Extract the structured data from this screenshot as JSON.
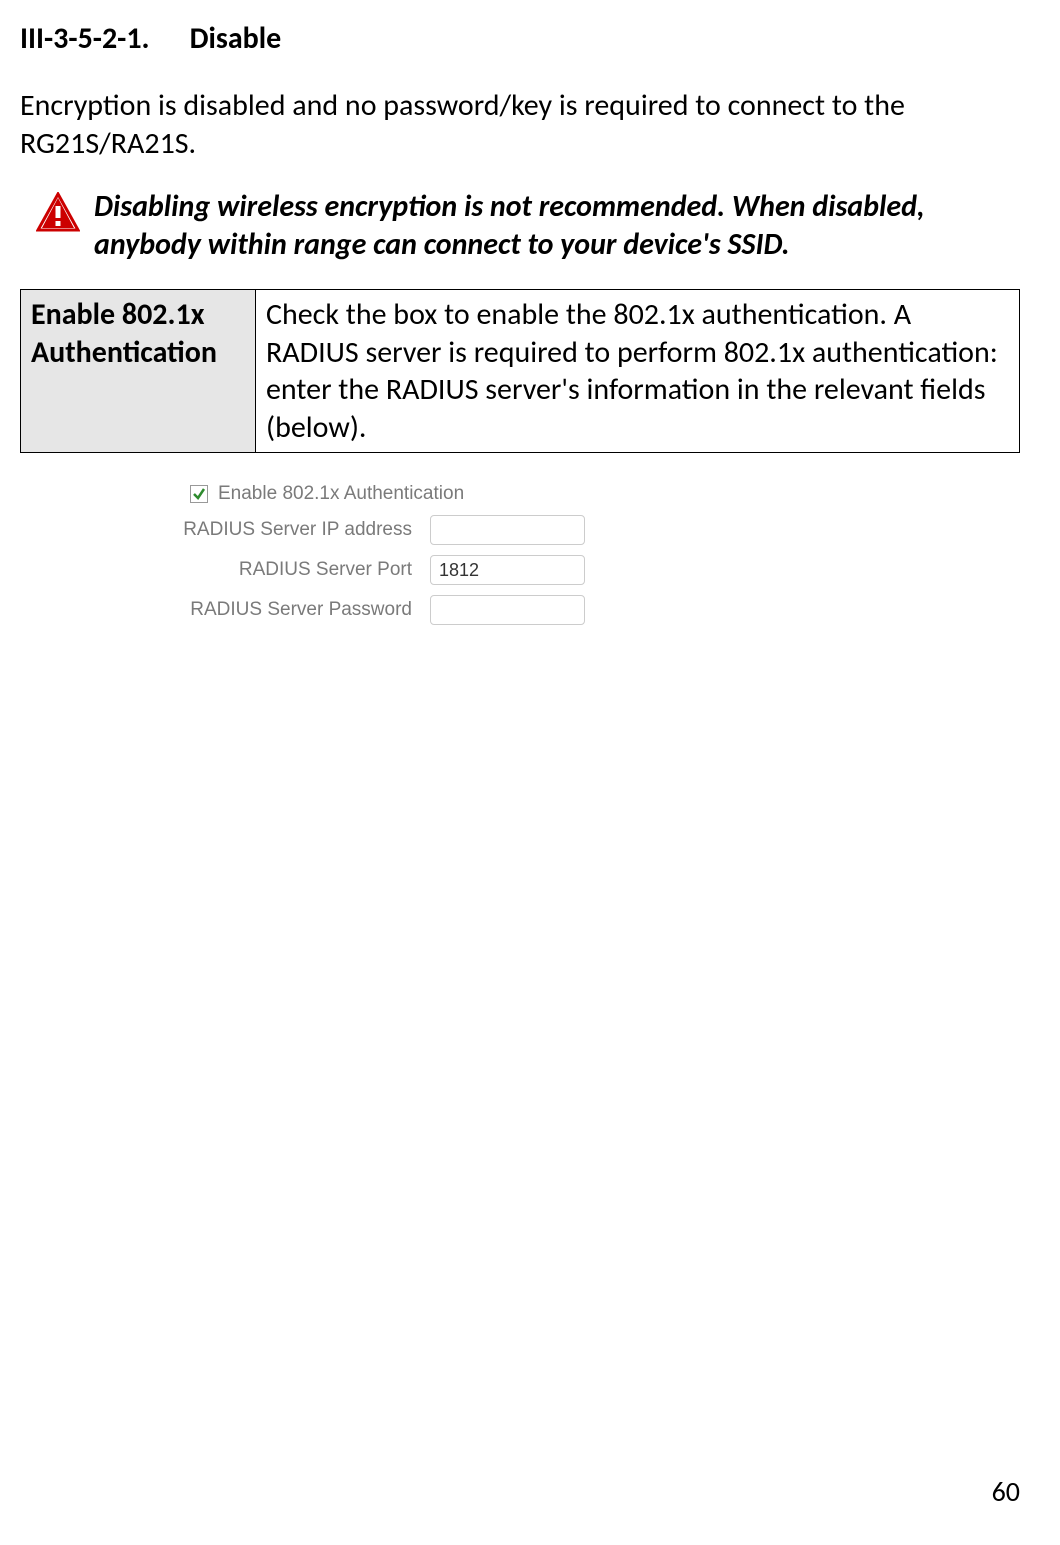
{
  "heading": {
    "number": "III-3-5-2-1.",
    "title": "Disable"
  },
  "intro": "Encryption is disabled and no password/key is required to connect to the RG21S/RA21S.",
  "warning": "Disabling wireless encryption is not recommended. When disabled, anybody within range can connect to your device's SSID.",
  "table": {
    "label": "Enable 802.1x Authentication",
    "desc": "Check the box to enable the 802.1x authentication. A RADIUS server is required to perform 802.1x authentication: enter the RADIUS server's information in the relevant fields (below)."
  },
  "form": {
    "enable_label": "Enable 802.1x Authentication",
    "enable_checked": true,
    "ip_label": "RADIUS Server IP address",
    "ip_value": "",
    "port_label": "RADIUS Server Port",
    "port_value": "1812",
    "pwd_label": "RADIUS Server Password",
    "pwd_value": ""
  },
  "page_number": "60"
}
